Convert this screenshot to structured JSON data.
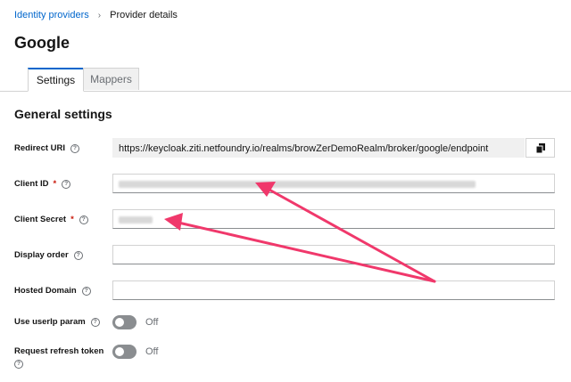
{
  "breadcrumb": {
    "parent": "Identity providers",
    "separator": "›",
    "current": "Provider details"
  },
  "page": {
    "title": "Google"
  },
  "tabs": [
    {
      "label": "Settings"
    },
    {
      "label": "Mappers"
    }
  ],
  "section": {
    "title": "General settings"
  },
  "fields": {
    "redirect_uri": {
      "label": "Redirect URI",
      "value": "https://keycloak.ziti.netfoundry.io/realms/browZerDemoRealm/broker/google/endpoint"
    },
    "client_id": {
      "label": "Client ID",
      "required": "*"
    },
    "client_secret": {
      "label": "Client Secret",
      "required": "*"
    },
    "display_order": {
      "label": "Display order"
    },
    "hosted_domain": {
      "label": "Hosted Domain"
    },
    "use_userip": {
      "label": "Use userIp param",
      "state": "Off"
    },
    "refresh_token": {
      "label": "Request refresh token",
      "state": "Off"
    }
  },
  "icons": {
    "help": "help-icon",
    "copy": "copy-icon",
    "breadcrumb_sep": "chevron-right-icon"
  },
  "colors": {
    "link": "#0066cc",
    "required": "#c9190b",
    "annotation_arrow": "#f0386b"
  }
}
